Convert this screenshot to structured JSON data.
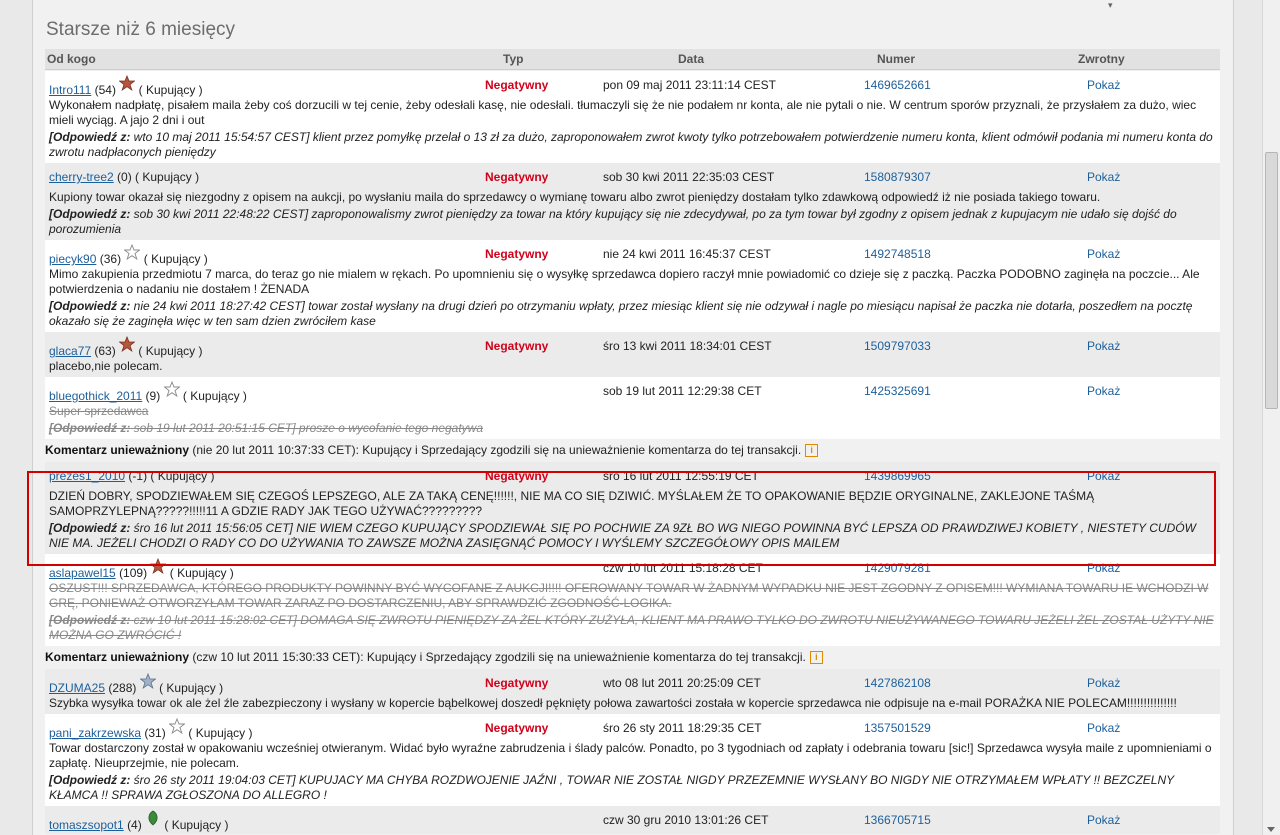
{
  "section_title": "Starsze niż 6 miesięcy",
  "columns": {
    "from": "Od kogo",
    "type": "Typ",
    "date": "Data",
    "number": "Numer",
    "returns": "Zwrotny"
  },
  "response_prefix": "Odpowiedź z:",
  "void_prefix": "Komentarz unieważniony",
  "void_text_suffix": "Kupujący i Sprzedający zgodzili się na unieważnienie komentarza do tej transakcji.",
  "entries": [
    {
      "user": "Intro111",
      "score": "(54)",
      "star": "red",
      "role": "( Kupujący )",
      "type": "Negatywny",
      "date": "pon 09 maj 2011 23:11:14 CEST",
      "number": "1469652661",
      "show": "Pokaż",
      "text": "Wykonałem nadpłatę, pisałem maila żeby coś dorzucili w tej cenie, żeby odesłali kasę, nie odesłali. tłumaczyli się że nie podałem nr konta, ale nie pytali o nie. W centrum sporów przyznali, że przysłałem za dużo, wiec mieli wyciąg. A jajo 2 dni i out",
      "response": "wto 10 maj 2011 15:54:57 CEST] klient przez pomyłkę przelał o 13 zł za dużo, zaproponowałem zwrot kwoty tylko potrzebowałem potwierdzenie numeru konta, klient odmówił podania mi numeru konta do zwrotu nadpłaconych pieniędzy"
    },
    {
      "user": "cherry-tree2",
      "score": "(0)",
      "star": "",
      "role": "( Kupujący )",
      "type": "Negatywny",
      "date": "sob 30 kwi 2011 22:35:03 CEST",
      "number": "1580879307",
      "show": "Pokaż",
      "text": "Kupiony towar okazał się niezgodny z opisem na aukcji, po wysłaniu maila do sprzedawcy o wymianę towaru albo zwrot pieniędzy dostałam tylko zdawkową odpowiedź iż nie posiada takiego towaru.",
      "response": "sob 30 kwi 2011 22:48:22 CEST] zaproponowalismy zwrot pieniędzy za towar na który kupujący się nie zdecydywał, po za tym towar był zgodny z opisem jednak z kupujacym nie udało się dojść do porozumienia"
    },
    {
      "user": "piecyk90",
      "score": "(36)",
      "star": "outline",
      "role": "( Kupujący )",
      "type": "Negatywny",
      "date": "nie 24 kwi 2011 16:45:37 CEST",
      "number": "1492748518",
      "show": "Pokaż",
      "text": "Mimo zakupienia przedmiotu 7 marca, do teraz go nie mialem w rękach. Po upomnieniu się o wysyłkę sprzedawca dopiero raczył mnie powiadomić co dzieje się z paczką. Paczka PODOBNO zaginęła na poczcie... Ale potwierdzenia o nadaniu nie dostałem ! ŻENADA",
      "response": "nie 24 kwi 2011 18:27:42 CEST] towar został wysłany na drugi dzień po otrzymaniu wpłaty, przez miesiąc klient się nie odzywał i nagle po miesiącu napisał że paczka nie dotarła, poszedłem na pocztę okazało się że zaginęła więc w ten sam dzien zwróciłem kase"
    },
    {
      "user": "glaca77",
      "score": "(63)",
      "star": "red",
      "role": "( Kupujący )",
      "type": "Negatywny",
      "date": "śro 13 kwi 2011 18:34:01 CEST",
      "number": "1509797033",
      "show": "Pokaż",
      "text": "placebo,nie polecam.",
      "response": ""
    },
    {
      "user": "bluegothick_2011",
      "score": "(9)",
      "star": "outline",
      "role": "( Kupujący )",
      "type": "",
      "date": "sob 19 lut 2011 12:29:38 CET",
      "number": "1425325691",
      "show": "Pokaż",
      "text": "Super sprzedawca",
      "response": "sob 19 lut 2011 20:51:15 CET] prosze o wycofanie tego negatywa",
      "struck": true,
      "void_date": "(nie 20 lut 2011 10:37:33 CET):"
    },
    {
      "user": "prezes1_2010",
      "score": "(-1)",
      "star": "",
      "role": "( Kupujący )",
      "type": "Negatywny",
      "date": "śro 16 lut 2011 12:55:19 CET",
      "number": "1439869965",
      "show": "Pokaż",
      "text": "DZIEŃ DOBRY, SPODZIEWAŁEM SIĘ CZEGOŚ LEPSZEGO, ALE ZA TAKĄ CENĘ!!!!!!, NIE MA CO SIĘ DZIWIĆ. MYŚLAŁEM ŻE TO OPAKOWANIE BĘDZIE ORYGINALNE, ZAKLEJONE TAŚMĄ SAMOPRZYLEPNĄ?????!!!!!11 A GDZIE RADY JAK TEGO UŻYWAĆ?????????",
      "response": "śro 16 lut 2011 15:56:05 CET] NIE WIEM CZEGO KUPUJĄCY SPODZIEWAŁ SIĘ PO POCHWIE ZA 9ZŁ BO WG NIEGO POWINNA BYĆ LEPSZA OD PRAWDZIWEJ KOBIETY , NIESTETY CUDÓW NIE MA. JEŻELI CHODZI O RADY CO DO UŻYWANIA TO ZAWSZE MOŻNA ZASIĘGNĄĆ POMOCY I WYŚLEMY SZCZEGÓŁOWY OPIS MAILEM"
    },
    {
      "user": "aslapawel15",
      "score": "(109)",
      "star": "red",
      "role": "( Kupujący )",
      "type": "",
      "date": "czw 10 lut 2011 15:18:28 CET",
      "number": "1429079281",
      "show": "Pokaż",
      "text": "OSZUST!!! SPRZEDAWCA, KTÓREGO PRODUKTY POWINNY BYĆ WYCOFANE Z AUKCJI!!!! OFEROWANY TOWAR W ŻADNYM WYPADKU NIE JEST ZGODNY Z OPISEM!!! WYMIANA TOWARU IE WCHODZI W GRĘ, PONIEWAŻ OTWORZYŁAM TOWAR ZARAZ PO DOSTARCZENIU, ABY SPRAWDZIĆ ZGODNOŚĆ-LOGIKA.",
      "response": "czw 10 lut 2011 15:28:02 CET] DOMAGA SIĘ ZWROTU PIENIĘDZY ZA ŻEL KTÓRY ZUŻYŁA, KLIENT MA PRAWO TYLKO DO ZWROTU NIEUŻYWANEGO TOWARU JEŻELI ŻEL ZOSTAŁ UŻYTY NIE MOŻNA GO ZWRÓCIĆ !",
      "struck": true,
      "void_date": "(czw 10 lut 2011 15:30:33 CET):"
    },
    {
      "user": "DZUMA25",
      "score": "(288)",
      "star": "blue",
      "role": "( Kupujący )",
      "type": "Negatywny",
      "date": "wto 08 lut 2011 20:25:09 CET",
      "number": "1427862108",
      "show": "Pokaż",
      "text": "Szybka wysyłka towar ok ale żel źle zabezpieczony i wysłany w kopercie bąbelkowej doszedł pęknięty połowa zawartości została w kopercie sprzedawca nie odpisuje na e-mail PORAŻKA NIE POLECAM!!!!!!!!!!!!!!!",
      "response": ""
    },
    {
      "user": "pani_zakrzewska",
      "score": "(31)",
      "star": "outline",
      "role": "( Kupujący )",
      "type": "Negatywny",
      "date": "śro 26 sty 2011 18:29:35 CET",
      "number": "1357501529",
      "show": "Pokaż",
      "text": "Towar dostarczony został w opakowaniu wcześniej otwieranym. Widać było wyraźne zabrudzenia i ślady palców. Ponadto, po 3 tygodniach od zapłaty i odebrania towaru [sic!] Sprzedawca wysyła maile z upomnieniami o zapłatę. Nieuprzejmie, nie polecam.",
      "response": "śro 26 sty 2011 19:04:03 CET] KUPUJACY MA CHYBA ROZDWOJENIE JAŹNI , TOWAR NIE ZOSTAŁ NIGDY PRZEZEMNIE WYSŁANY BO NIGDY NIE OTRZYMAŁEM WPŁATY !! BEZCZELNY KŁAMCA !! SPRAWA ZGŁOSZONA DO ALLEGRO !"
    },
    {
      "user": "tomaszsopot1",
      "score": "(4)",
      "star": "green",
      "role": "( Kupujący )",
      "type": "",
      "date": "czw 30 gru 2010 13:01:26 CET",
      "number": "1366705715",
      "show": "Pokaż",
      "text": "",
      "response": ""
    }
  ],
  "colors": {
    "negative": "#d0021b",
    "link": "#1d5f9a",
    "highlight": "#d40000"
  }
}
